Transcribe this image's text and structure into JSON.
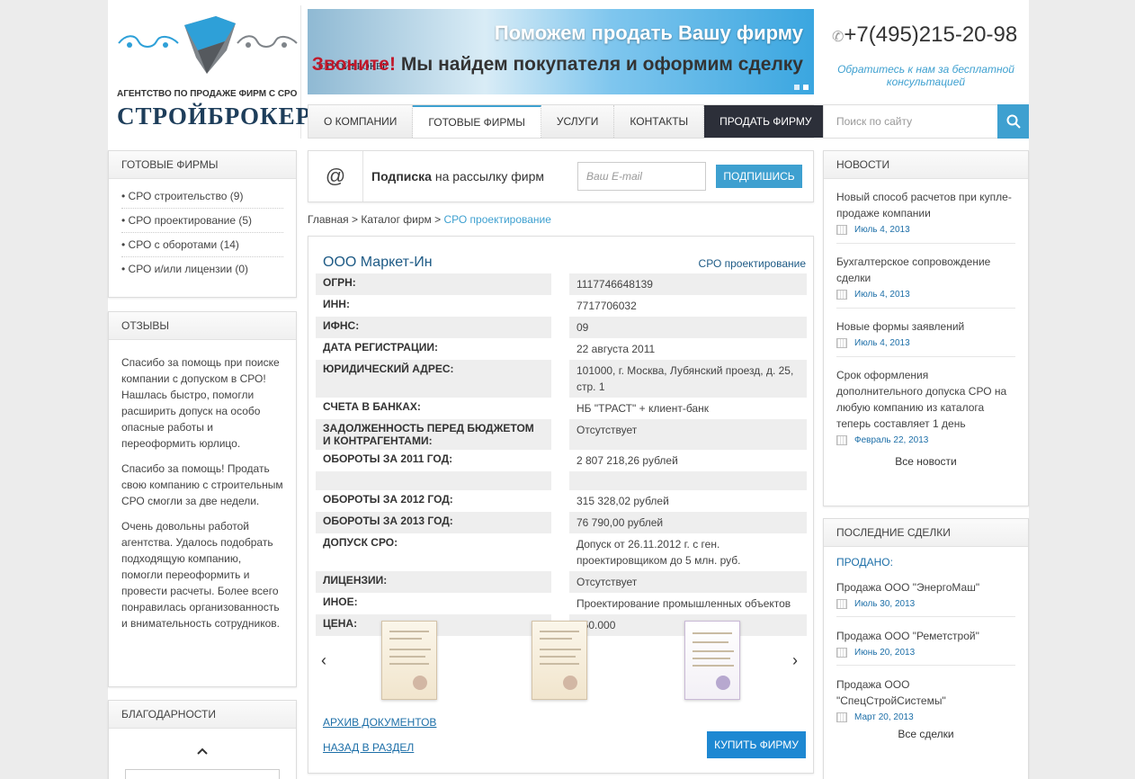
{
  "header": {
    "logo_sub": "АГЕНТСТВО ПО ПРОДАЖЕ ФИРМ С СРО",
    "logo_title": "СТРОЙБРОКЕР",
    "banner_brand": "СТРОЙБРОКЕР",
    "banner_line1": "Поможем продать Вашу фирму",
    "banner_call": "Звоните!",
    "banner_line2": "Мы найдем покупателя и оформим сделку",
    "phone": "+7(495)215-20-98",
    "consult": "Обратитесь к нам за бесплатной консультацией"
  },
  "nav": {
    "items": [
      "О КОМПАНИИ",
      "ГОТОВЫЕ ФИРМЫ",
      "УСЛУГИ",
      "КОНТАКТЫ"
    ],
    "sell": "ПРОДАТЬ ФИРМУ",
    "active": "ГОТОВЫЕ ФИРМЫ"
  },
  "search": {
    "placeholder": "Поиск по сайту"
  },
  "left": {
    "firms_title": "ГОТОВЫЕ ФИРМЫ",
    "firms": [
      "СРО строительство (9)",
      "СРО проектирование (5)",
      "СРО с оборотами (14)",
      "СРО и/или лицензии (0)"
    ],
    "reviews_title": "ОТЗЫВЫ",
    "reviews": [
      "Спасибо за помощь при поиске компании с допуском в СРО! Нашлась быстро, помогли расширить допуск на особо опасные работы и переоформить юрлицо.",
      "Спасибо за помощь! Продать свою компанию с строительным СРО смогли за две недели.",
      "Очень довольны работой агентства. Удалось подобрать подходящую компанию, помогли переоформить и провести расчеты. Более всего понравилась организованность и внимательность сотрудников."
    ],
    "thanks_title": "БЛАГОДАРНОСТИ"
  },
  "subscribe": {
    "text_bold": "Подписка",
    "text_rest": " на рассылку фирм",
    "placeholder": "Ваш E-mail",
    "button": "ПОДПИШИСЬ"
  },
  "breadcrumb": {
    "path": "Главная > Каталог фирм > ",
    "current": "СРО проектирование"
  },
  "firm": {
    "name": "ООО Маркет-Ин",
    "category": "СРО проектирование",
    "rows": [
      {
        "k": "ОГРН:",
        "v": "1117746648139"
      },
      {
        "k": "ИНН:",
        "v": "7717706032"
      },
      {
        "k": "ИФНС:",
        "v": "09"
      },
      {
        "k": "ДАТА РЕГИСТРАЦИИ:",
        "v": "22 августа 2011"
      },
      {
        "k": "ЮРИДИЧЕСКИЙ АДРЕС:",
        "v": "101000, г. Москва, Лубянский проезд, д. 25, стр. 1"
      },
      {
        "k": "СЧЕТА В БАНКАХ:",
        "v": "НБ \"ТРАСТ\" + клиент-банк"
      },
      {
        "k": "ЗАДОЛЖЕННОСТЬ ПЕРЕД БЮДЖЕТОМ И КОНТРАГЕНТАМИ:",
        "v": "Отсутствует"
      },
      {
        "k": "ОБОРОТЫ ЗА 2011 ГОД:",
        "v": "2 807 218,26 рублей"
      },
      {
        "k": "",
        "v": ""
      },
      {
        "k": "ОБОРОТЫ ЗА 2012 ГОД:",
        "v": "315 328,02 рублей"
      },
      {
        "k": "ОБОРОТЫ ЗА 2013 ГОД:",
        "v": "76 790,00 рублей"
      },
      {
        "k": "ДОПУСК СРО:",
        "v": "Допуск от 26.11.2012 г. с ген. проектировщиком до 5 млн. руб."
      },
      {
        "k": "ЛИЦЕНЗИИ:",
        "v": "Отсутствует"
      },
      {
        "k": "ИНОЕ:",
        "v": "Проектирование промышленных объектов"
      },
      {
        "k": "ЦЕНА:",
        "v": "550.000"
      }
    ],
    "archive_link": "АРХИВ ДОКУМЕНТОВ",
    "back_link": "НАЗАД В РАЗДЕЛ",
    "buy_button": "КУПИТЬ ФИРМУ"
  },
  "news": {
    "title": "НОВОСТИ",
    "items": [
      {
        "title": "Новый способ расчетов при купле-продаже компании",
        "date": "Июль 4, 2013"
      },
      {
        "title": "Бухгалтерское сопровождение сделки",
        "date": "Июль 4, 2013"
      },
      {
        "title": "Новые формы заявлений",
        "date": "Июль 4, 2013"
      },
      {
        "title": "Срок оформления дополнительного допуска СРО на любую компанию из каталога теперь составляет 1 день",
        "date": "Февраль 22, 2013"
      }
    ],
    "all": "Все новости"
  },
  "deals": {
    "title": "ПОСЛЕДНИЕ СДЕЛКИ",
    "sold": "ПРОДАНО:",
    "items": [
      {
        "title": "Продажа ООО \"ЭнергоМаш\"",
        "date": "Июль 30, 2013"
      },
      {
        "title": "Продажа ООО \"Реметстрой\"",
        "date": "Июнь 20, 2013"
      },
      {
        "title": "Продажа ООО \"СпецСтройСистемы\"",
        "date": "Март 20, 2013"
      }
    ],
    "all": "Все сделки"
  },
  "colors": {
    "accent": "#3ea0d0",
    "nav_dark": "#2c2f39",
    "link": "#1d6fa8",
    "buy": "#1e88d2"
  }
}
